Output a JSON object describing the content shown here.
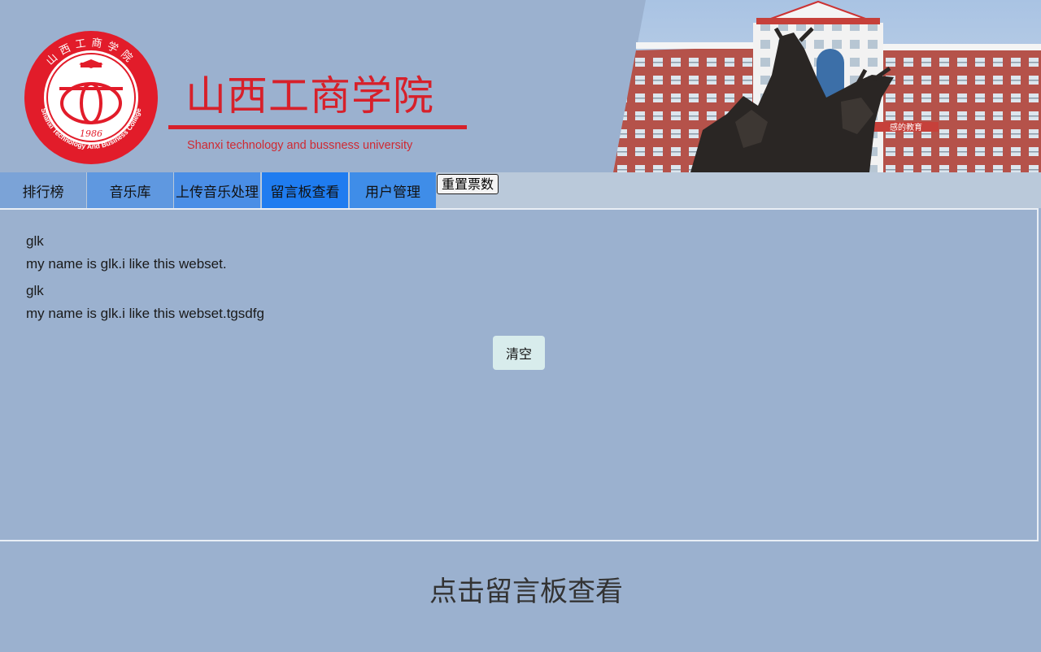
{
  "header": {
    "seal_top_text": "山西工商学院",
    "seal_ring_text": "Shanxi Technology And Business College",
    "seal_year": "1986",
    "title": "山西工商学院",
    "subtitle": "Shanxi technology and bussness university",
    "building_sign": "感的教育"
  },
  "nav": {
    "items": [
      {
        "label": "排行榜",
        "color": "#7ba3d7"
      },
      {
        "label": "音乐库",
        "color": "#5f98e0"
      },
      {
        "label": "上传音乐处理",
        "color": "#4a8ee6"
      },
      {
        "label": "留言板查看",
        "color": "#1f7cf0"
      },
      {
        "label": "用户管理",
        "color": "#3f8de8"
      }
    ],
    "reset_label": "重置票数"
  },
  "messages": [
    {
      "user": "glk",
      "text": "my name is glk.i like this webset."
    },
    {
      "user": "glk",
      "text": "my name is glk.i like this webset.tgsdfg"
    }
  ],
  "clear_label": "清空",
  "footer_text": "点击留言板查看",
  "colors": {
    "background": "#9bb1cf",
    "brand_red": "#d7202a",
    "nav_bar": "#bac9da"
  }
}
